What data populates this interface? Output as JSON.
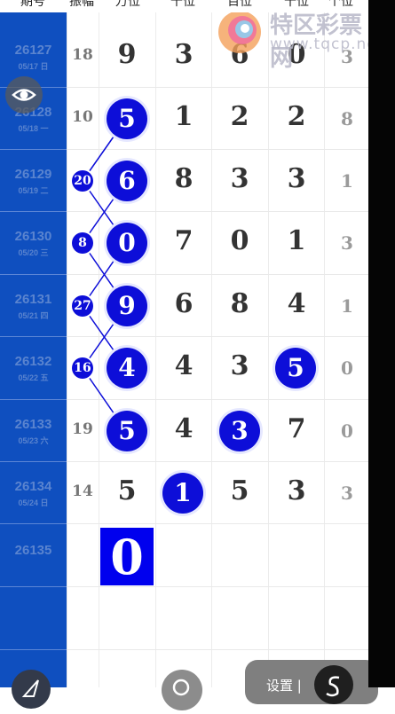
{
  "header": {
    "columns": [
      "期号",
      "振幅",
      "万位",
      "千位",
      "百位",
      "十位",
      "个位"
    ]
  },
  "logo": {
    "title": "特区彩票网",
    "url": "www.tqcp.net"
  },
  "icons": {
    "eye": "eye-icon",
    "send": "send-icon",
    "search": "search-icon",
    "settings": "s-icon"
  },
  "colors": {
    "sidebar": "#0f4fbf",
    "ball": "#0d0ed8",
    "new_draw": "#0000ee"
  },
  "rows": [
    {
      "issue": "26127",
      "date": "05/17 日",
      "sum": "18",
      "digits": [
        "9",
        "3",
        "6",
        "0",
        "3"
      ]
    },
    {
      "issue": "26128",
      "date": "05/18 一",
      "sum": "10",
      "digits": [
        "5",
        "1",
        "2",
        "2",
        "8"
      ]
    },
    {
      "issue": "26129",
      "date": "05/19 二",
      "sum": "",
      "digits": [
        "6",
        "8",
        "3",
        "3",
        "1"
      ]
    },
    {
      "issue": "26130",
      "date": "05/20 三",
      "sum": "",
      "digits": [
        "0",
        "7",
        "0",
        "1",
        "3"
      ]
    },
    {
      "issue": "26131",
      "date": "05/21 四",
      "sum": "",
      "digits": [
        "9",
        "6",
        "8",
        "4",
        "1"
      ]
    },
    {
      "issue": "26132",
      "date": "05/22 五",
      "sum": "",
      "digits": [
        "4",
        "4",
        "3",
        "5",
        "0"
      ]
    },
    {
      "issue": "26133",
      "date": "05/23 六",
      "sum": "19",
      "digits": [
        "5",
        "4",
        "3",
        "7",
        "0"
      ]
    },
    {
      "issue": "26134",
      "date": "05/24 日",
      "sum": "14",
      "digits": [
        "5",
        "1",
        "5",
        "3",
        "3"
      ]
    },
    {
      "issue": "26135",
      "date": "",
      "sum": "",
      "digits": [
        "0",
        "",
        "",
        "",
        ""
      ]
    }
  ],
  "tags": [
    "20",
    "8",
    "27",
    "16"
  ],
  "bottom": {
    "settings_label": "设置 |"
  }
}
